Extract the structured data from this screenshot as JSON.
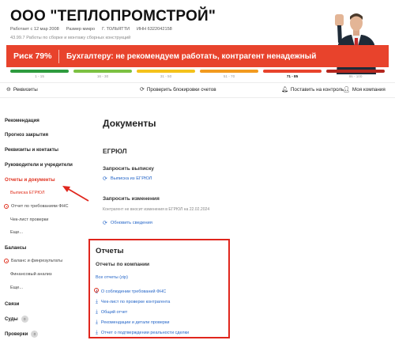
{
  "company": {
    "title": "ООО \"ТЕПЛОПРОМСТРОЙ\"",
    "meta": [
      "Работает с 12 мар 2008",
      "Размер микро",
      "Г. ТОЛЬЯТТИ",
      "ИНН 6322042158"
    ],
    "description": "43.99.7 Работы по сборке и монтажу сборных конструкций"
  },
  "risk": {
    "percent": "Риск 79%",
    "message": "Бухгалтеру: не рекомендуем работать, контрагент ненадежный",
    "color": "#e8432c"
  },
  "scale": [
    {
      "label": "1 - 15",
      "color": "#2e9b3e"
    },
    {
      "label": "16 - 30",
      "color": "#7cc142"
    },
    {
      "label": "31 - 50",
      "color": "#f4c21b"
    },
    {
      "label": "51 - 70",
      "color": "#f29a1f"
    },
    {
      "label": "71 - 85",
      "color": "#e8432c"
    },
    {
      "label": "86 - 100",
      "color": "#b3261e"
    }
  ],
  "toolbar": {
    "requisites": "Реквизиты",
    "check_blocks": "Проверить блокировки счетов",
    "monitor": "Поставить на контроль",
    "my_company": "Моя компания"
  },
  "sidebar": {
    "recommendation": "Рекомендация",
    "forecast": "Прогноз закрытия",
    "requisites_contacts": "Реквизиты и контакты",
    "managers": "Руководители и учредители",
    "reports_docs": "Отчеты и документы",
    "egrul_extract": "Выписка ЕГРЮЛ",
    "fns_report": "Отчет по требованиям ФНС",
    "checklist": "Чек-лист проверки",
    "more1": "Еще...",
    "balances": "Балансы",
    "balance_fin": "Баланс и финрезультаты",
    "fin_analysis": "Финансовый анализ",
    "more2": "Еще...",
    "links": "Связи",
    "courts": "Суды",
    "courts_count": "0",
    "inspections": "Проверки",
    "inspections_count": "0"
  },
  "main": {
    "heading": "Документы",
    "egrul": "ЕГРЮЛ",
    "request_extract": "Запросить выписку",
    "egrul_extract_link": "Выписка из ЕГРЮЛ",
    "request_changes": "Запросить изменения",
    "no_changes": "Контрагент не вносит изменения в ЕГРЮЛ на 22.02.2024",
    "refresh": "Обновить сведения"
  },
  "reports": {
    "title": "Отчеты",
    "by_company": "Отчеты по компании",
    "all_zip": "Все отчеты (zip)",
    "items": [
      "О соблюдении требований ФНС",
      "Чек-лист по проверке контрагента",
      "Общий отчет",
      "Рекомендации и детали проверки",
      "Отчет о подтверждении реальности сделки"
    ]
  },
  "colors": {
    "accent_red": "#e0261d",
    "link_blue": "#2566c8"
  }
}
